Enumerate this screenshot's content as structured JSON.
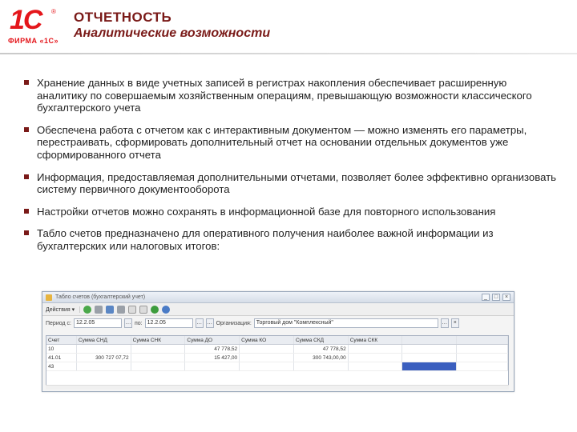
{
  "logo": {
    "mark": "1C",
    "reg": "®",
    "subtitle": "ФИРМА «1С»"
  },
  "header": {
    "title": "ОТЧЕТНОСТЬ",
    "subtitle": "Аналитические возможности"
  },
  "bullets": [
    "Хранение данных в виде учетных записей в регистрах накопления обеспечивает расширенную аналитику по совершаемым хозяйственным операциям, превышающую возможности классического бухгалтерского учета",
    "Обеспечена работа с отчетом как с интерактивным документом — можно изменять его параметры, перестраивать, сформировать дополнительный отчет на основании отдельных документов уже сформированного отчета",
    "Информация, предоставляемая дополнительными отчетами, позволяет более эффективно организовать систему первичного документооборота",
    "Настройки отчетов можно сохранять в информационной базе для повторного использования",
    "Табло счетов предназначено для оперативного получения наиболее важной информации из бухгалтерских или налоговых итогов:"
  ],
  "screenshot": {
    "window_title": "Табло счетов (бухгалтерский учет)",
    "toolbar": {
      "actions_label": "Действия ▾"
    },
    "filters": {
      "period_label": "Период с:",
      "date_from": "12.2.05",
      "to_label": "по:",
      "date_to": "12.2.05",
      "org_label": "Организация:",
      "org_value": "Торговый дом \"Комплексный\""
    },
    "columns": [
      "Счет",
      "Сумма СНД",
      "Сумма СНК",
      "Сумма ДО",
      "Сумма КО",
      "Сумма СКД",
      "Сумма СКК",
      "",
      ""
    ],
    "rows": [
      [
        "10",
        "",
        "",
        "47 778,52",
        "",
        "47 778,52",
        "",
        "",
        ""
      ],
      [
        "41.01",
        "300 727 07,72",
        "",
        "15 427,00",
        "",
        "300 743,00,00",
        "",
        "",
        ""
      ],
      [
        "43",
        "",
        "",
        "",
        "",
        "",
        "",
        "",
        ""
      ]
    ]
  }
}
